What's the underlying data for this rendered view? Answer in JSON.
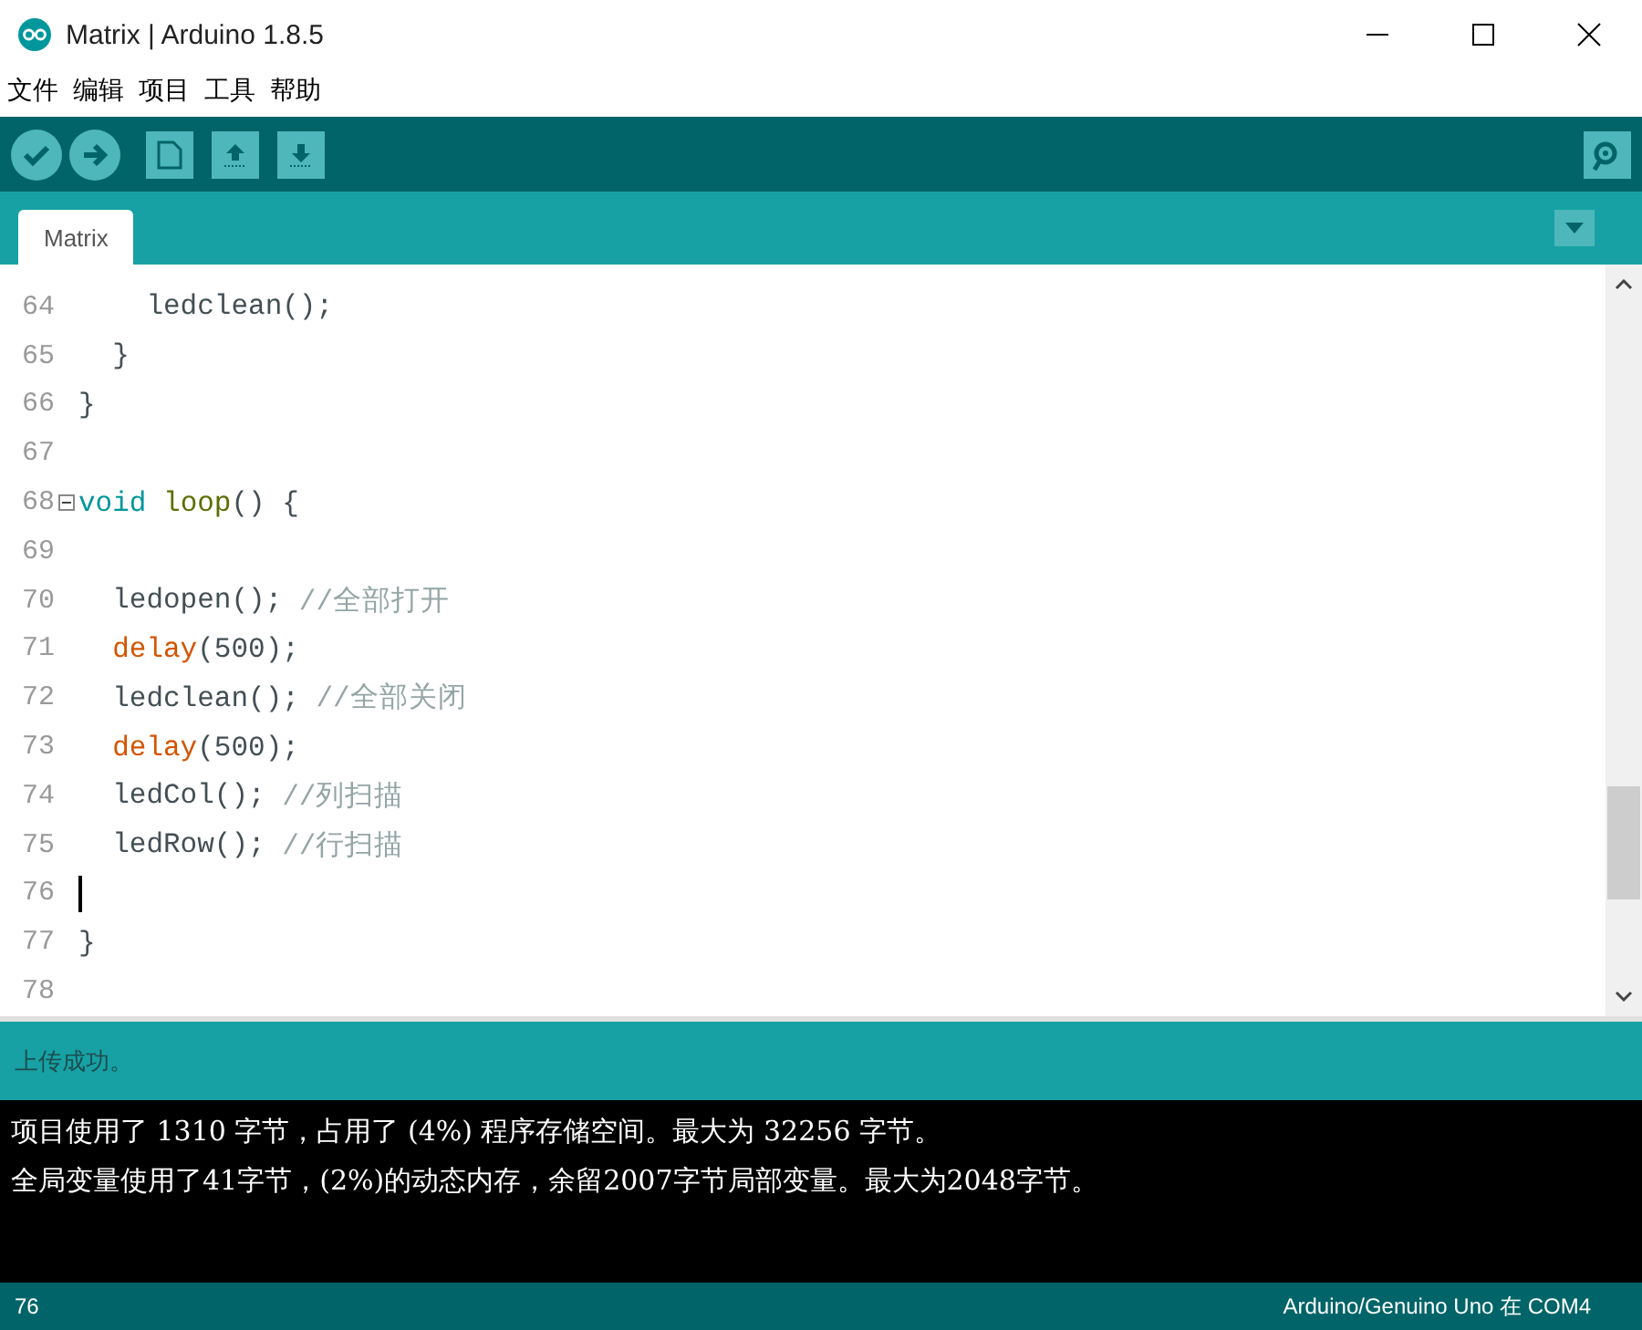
{
  "window": {
    "title": "Matrix | Arduino 1.8.5"
  },
  "menu": [
    "文件",
    "编辑",
    "项目",
    "工具",
    "帮助"
  ],
  "tabs": [
    {
      "label": "Matrix",
      "selected": true
    }
  ],
  "editor": {
    "lines": [
      {
        "number": "64",
        "tokens": [
          {
            "kind": "plain",
            "text": "    ledclean();"
          }
        ]
      },
      {
        "number": "65",
        "tokens": [
          {
            "kind": "plain",
            "text": "  }"
          }
        ]
      },
      {
        "number": "66",
        "tokens": [
          {
            "kind": "plain",
            "text": "}"
          }
        ]
      },
      {
        "number": "67"
      },
      {
        "number": "68",
        "fold": true,
        "tokens": [
          {
            "kind": "keyword",
            "text": "void "
          },
          {
            "kind": "function",
            "text": "loop"
          },
          {
            "kind": "plain",
            "text": "() {"
          }
        ]
      },
      {
        "number": "69"
      },
      {
        "number": "70",
        "tokens": [
          {
            "kind": "plain",
            "text": "  ledopen(); "
          },
          {
            "kind": "comment",
            "text": "//全部打开"
          }
        ]
      },
      {
        "number": "71",
        "tokens": [
          {
            "kind": "builtin",
            "text": "  delay"
          },
          {
            "kind": "plain",
            "text": "(500);"
          }
        ]
      },
      {
        "number": "72",
        "tokens": [
          {
            "kind": "plain",
            "text": "  ledclean(); "
          },
          {
            "kind": "comment",
            "text": "//全部关闭"
          }
        ]
      },
      {
        "number": "73",
        "tokens": [
          {
            "kind": "builtin",
            "text": "  delay"
          },
          {
            "kind": "plain",
            "text": "(500);"
          }
        ]
      },
      {
        "number": "74",
        "tokens": [
          {
            "kind": "plain",
            "text": "  ledCol(); "
          },
          {
            "kind": "comment",
            "text": "//列扫描"
          }
        ]
      },
      {
        "number": "75",
        "tokens": [
          {
            "kind": "plain",
            "text": "  ledRow(); "
          },
          {
            "kind": "comment",
            "text": "//行扫描"
          }
        ]
      },
      {
        "number": "76",
        "cursor": true
      },
      {
        "number": "77",
        "tokens": [
          {
            "kind": "plain",
            "text": "}"
          }
        ]
      },
      {
        "number": "78"
      }
    ]
  },
  "message": "上传成功。",
  "console": [
    "项目使用了 1310 字节，占用了 (4%) 程序存储空间。最大为 32256 字节。",
    "全局变量使用了41字节，(2%)的动态内存，余留2007字节局部变量。最大为2048字节。"
  ],
  "status_bar": {
    "line": "76",
    "board": "Arduino/Genuino Uno 在 COM4"
  }
}
